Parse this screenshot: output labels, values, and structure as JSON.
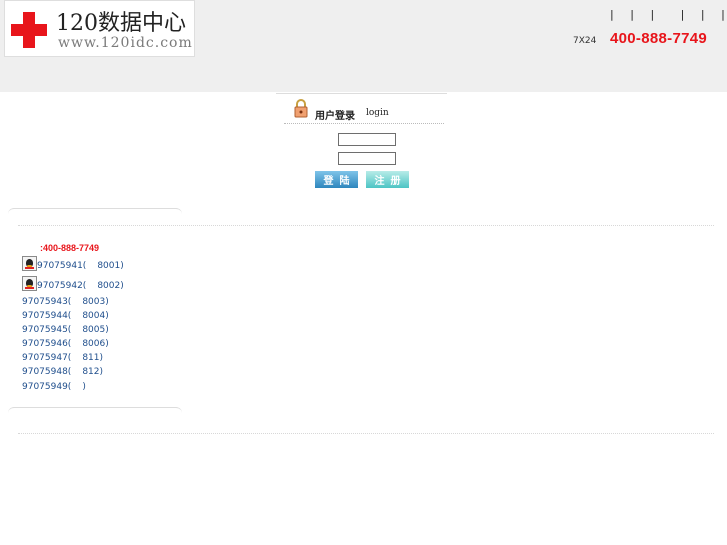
{
  "header": {
    "logo_title": "120数据中心",
    "logo_url": "www.120idc.com",
    "top_links": [
      "|",
      "|",
      "|",
      "|",
      "|",
      "|"
    ],
    "service_hours": "7X24",
    "hotline": "400-888-7749",
    "colors": {
      "brand_red": "#e8151b",
      "header_bg": "#efefef"
    }
  },
  "login": {
    "title": "用户登录",
    "title_en": "login",
    "username_value": "",
    "password_value": "",
    "login_button": "登陆",
    "register_button": "注册",
    "icon": "lock-icon"
  },
  "support": {
    "phone": ":400-888-7749",
    "qq_list": [
      {
        "number": "97075941(",
        "ext": "8001)",
        "icon": true
      },
      {
        "number": "97075942(",
        "ext": "8002)",
        "icon": true
      },
      {
        "number": "97075943(",
        "ext": "8003)",
        "icon": false
      },
      {
        "number": "97075944(",
        "ext": "8004)",
        "icon": false
      },
      {
        "number": "97075945(",
        "ext": "8005)",
        "icon": false
      },
      {
        "number": "97075946(",
        "ext": "8006)",
        "icon": false
      },
      {
        "number": "97075947(",
        "ext": "811)",
        "icon": false
      },
      {
        "number": "97075948(",
        "ext": "812)",
        "icon": false
      },
      {
        "number": "97075949(",
        "ext": ")",
        "icon": false
      }
    ]
  }
}
